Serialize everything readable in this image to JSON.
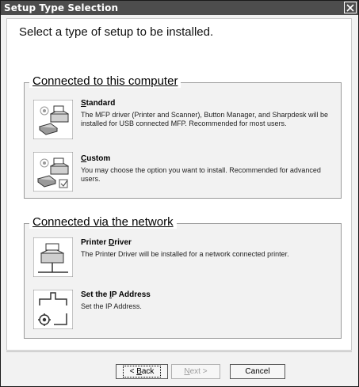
{
  "window": {
    "title": "Setup Type Selection"
  },
  "heading": "Select a type of setup to be installed.",
  "groups": {
    "computer": {
      "title": "Connected to this computer",
      "options": [
        {
          "title_pre": "",
          "title_u": "S",
          "title_post": "tandard",
          "desc": "The MFP driver (Printer and Scanner), Button Manager, and Sharpdesk will be installed for USB connected MFP.  Recommended for most users."
        },
        {
          "title_pre": "",
          "title_u": "C",
          "title_post": "ustom",
          "desc": "You may choose the option you want to install. Recommended for advanced users."
        }
      ]
    },
    "network": {
      "title": "Connected via the network",
      "options": [
        {
          "title_pre": "Printer ",
          "title_u": "D",
          "title_post": "river",
          "desc": "The Printer Driver will be installed for a network connected printer."
        },
        {
          "title_pre": "Set the ",
          "title_u": "I",
          "title_post": "P Address",
          "desc": "Set the IP Address."
        }
      ]
    }
  },
  "buttons": {
    "back": {
      "u": "B",
      "rest": "ack",
      "prefix": "< "
    },
    "next": {
      "u": "N",
      "rest": "ext >",
      "prefix": ""
    },
    "cancel": "Cancel"
  }
}
